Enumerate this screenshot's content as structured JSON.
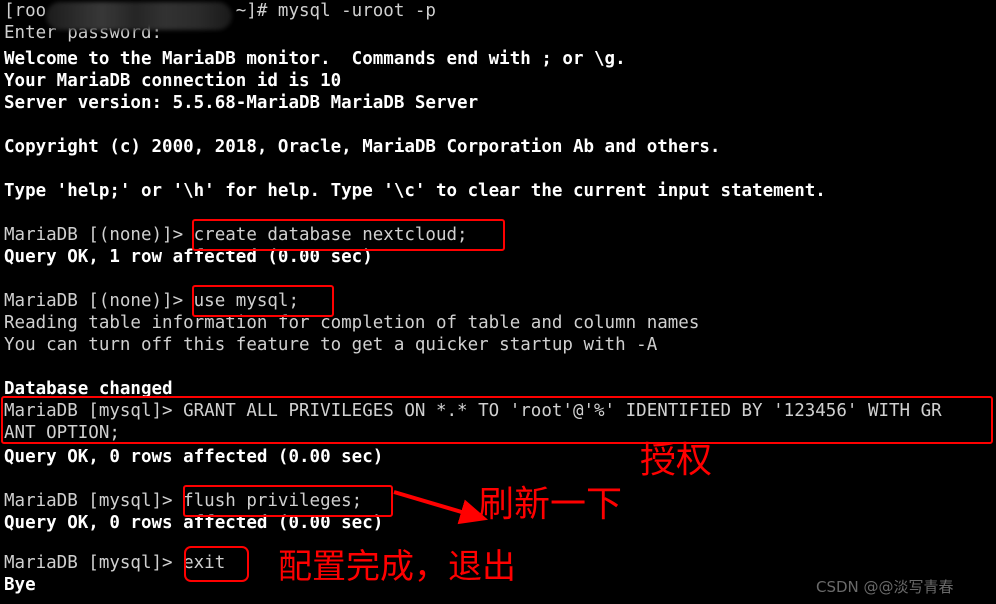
{
  "terminal": {
    "background_color": "#000000",
    "text_color": "#d0d0d0",
    "bold_text_color": "#ffffff",
    "accent_color": "#ff0000",
    "lines": [
      {
        "id": "l01",
        "text": "[roo                  ~]# mysql -uroot -p",
        "bold": false
      },
      {
        "id": "l02",
        "text": "Enter password:",
        "bold": false
      },
      {
        "id": "l03",
        "text": "Welcome to the MariaDB monitor.  Commands end with ; or \\g.",
        "bold": true
      },
      {
        "id": "l04",
        "text": "Your MariaDB connection id is 10",
        "bold": true
      },
      {
        "id": "l05",
        "text": "Server version: 5.5.68-MariaDB MariaDB Server",
        "bold": true
      },
      {
        "id": "l06",
        "text": "",
        "bold": false
      },
      {
        "id": "l07",
        "text": "Copyright (c) 2000, 2018, Oracle, MariaDB Corporation Ab and others.",
        "bold": true
      },
      {
        "id": "l08",
        "text": "",
        "bold": false
      },
      {
        "id": "l09",
        "text": "Type 'help;' or '\\h' for help. Type '\\c' to clear the current input statement.",
        "bold": true
      },
      {
        "id": "l10",
        "text": "",
        "bold": false
      },
      {
        "id": "l11",
        "text": "MariaDB [(none)]> create database nextcloud;",
        "bold": false
      },
      {
        "id": "l12",
        "text": "Query OK, 1 row affected (0.00 sec)",
        "bold": true
      },
      {
        "id": "l13",
        "text": "",
        "bold": false
      },
      {
        "id": "l14",
        "text": "MariaDB [(none)]> use mysql;",
        "bold": false
      },
      {
        "id": "l15",
        "text": "Reading table information for completion of table and column names",
        "bold": false
      },
      {
        "id": "l16",
        "text": "You can turn off this feature to get a quicker startup with -A",
        "bold": false
      },
      {
        "id": "l17",
        "text": "",
        "bold": false
      },
      {
        "id": "l18",
        "text": "Database changed",
        "bold": true
      },
      {
        "id": "l19",
        "text": "MariaDB [mysql]> GRANT ALL PRIVILEGES ON *.* TO 'root'@'%' IDENTIFIED BY '123456' WITH GR",
        "bold": false
      },
      {
        "id": "l20",
        "text": "ANT OPTION;",
        "bold": false
      },
      {
        "id": "l21",
        "text": "Query OK, 0 rows affected (0.00 sec)",
        "bold": true
      },
      {
        "id": "l22",
        "text": "",
        "bold": false
      },
      {
        "id": "l23",
        "text": "MariaDB [mysql]> flush privileges;",
        "bold": false
      },
      {
        "id": "l24",
        "text": "Query OK, 0 rows affected (0.00 sec)",
        "bold": true
      },
      {
        "id": "l25",
        "text": "",
        "bold": false
      },
      {
        "id": "l26",
        "text": "MariaDB [mysql]> exit",
        "bold": false
      },
      {
        "id": "l27",
        "text": "Bye",
        "bold": true
      }
    ]
  },
  "commands": {
    "login": "mysql -uroot -p",
    "create_database": "create database nextcloud;",
    "use_database": "use mysql;",
    "grant": "GRANT ALL PRIVILEGES ON *.* TO 'root'@'%' IDENTIFIED BY '123456' WITH GRANT OPTION;",
    "flush": "flush privileges;",
    "exit": "exit"
  },
  "annotations": [
    {
      "id": "a1",
      "text": "授权",
      "meaning": "grant-privileges"
    },
    {
      "id": "a2",
      "text": "刷新一下",
      "meaning": "refresh-once"
    },
    {
      "id": "a3",
      "text": "配置完成，退出",
      "meaning": "configuration-done-exit"
    }
  ],
  "watermark": {
    "text": "CSDN @@淡写青春"
  },
  "redaction": {
    "label": "hostname-redacted"
  }
}
